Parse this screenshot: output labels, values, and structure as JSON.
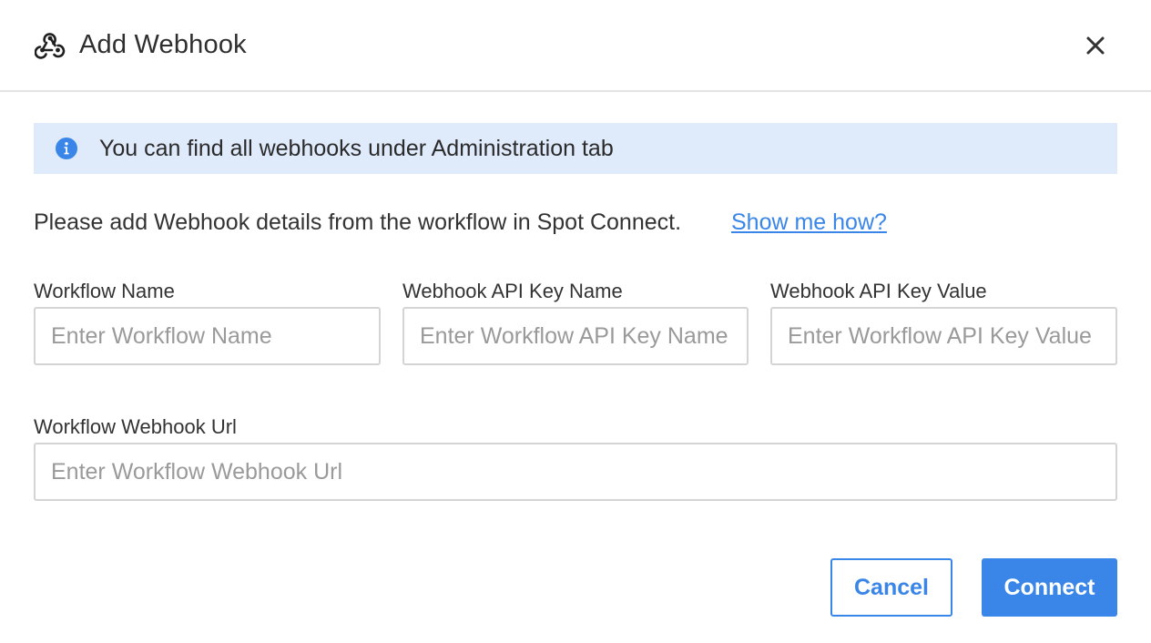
{
  "dialog": {
    "title": "Add Webhook",
    "title_icon": "webhook-icon",
    "close_icon": "close-icon"
  },
  "info_banner": {
    "icon": "info-icon",
    "text": "You can find all webhooks under Administration tab"
  },
  "description": {
    "text": "Please add Webhook details from the workflow in Spot Connect.",
    "link_label": "Show me how?"
  },
  "form": {
    "workflow_name": {
      "label": "Workflow Name",
      "placeholder": "Enter Workflow Name",
      "value": ""
    },
    "api_key_name": {
      "label": "Webhook API Key Name",
      "placeholder": "Enter Workflow API Key Name",
      "value": ""
    },
    "api_key_value": {
      "label": "Webhook API Key Value",
      "placeholder": "Enter Workflow API Key Value",
      "value": ""
    },
    "webhook_url": {
      "label": "Workflow Webhook Url",
      "placeholder": "Enter Workflow Webhook Url",
      "value": ""
    }
  },
  "actions": {
    "cancel_label": "Cancel",
    "connect_label": "Connect"
  },
  "colors": {
    "accent": "#3a86e8",
    "banner_bg": "#dfeafb",
    "border": "#d4d4d4"
  }
}
